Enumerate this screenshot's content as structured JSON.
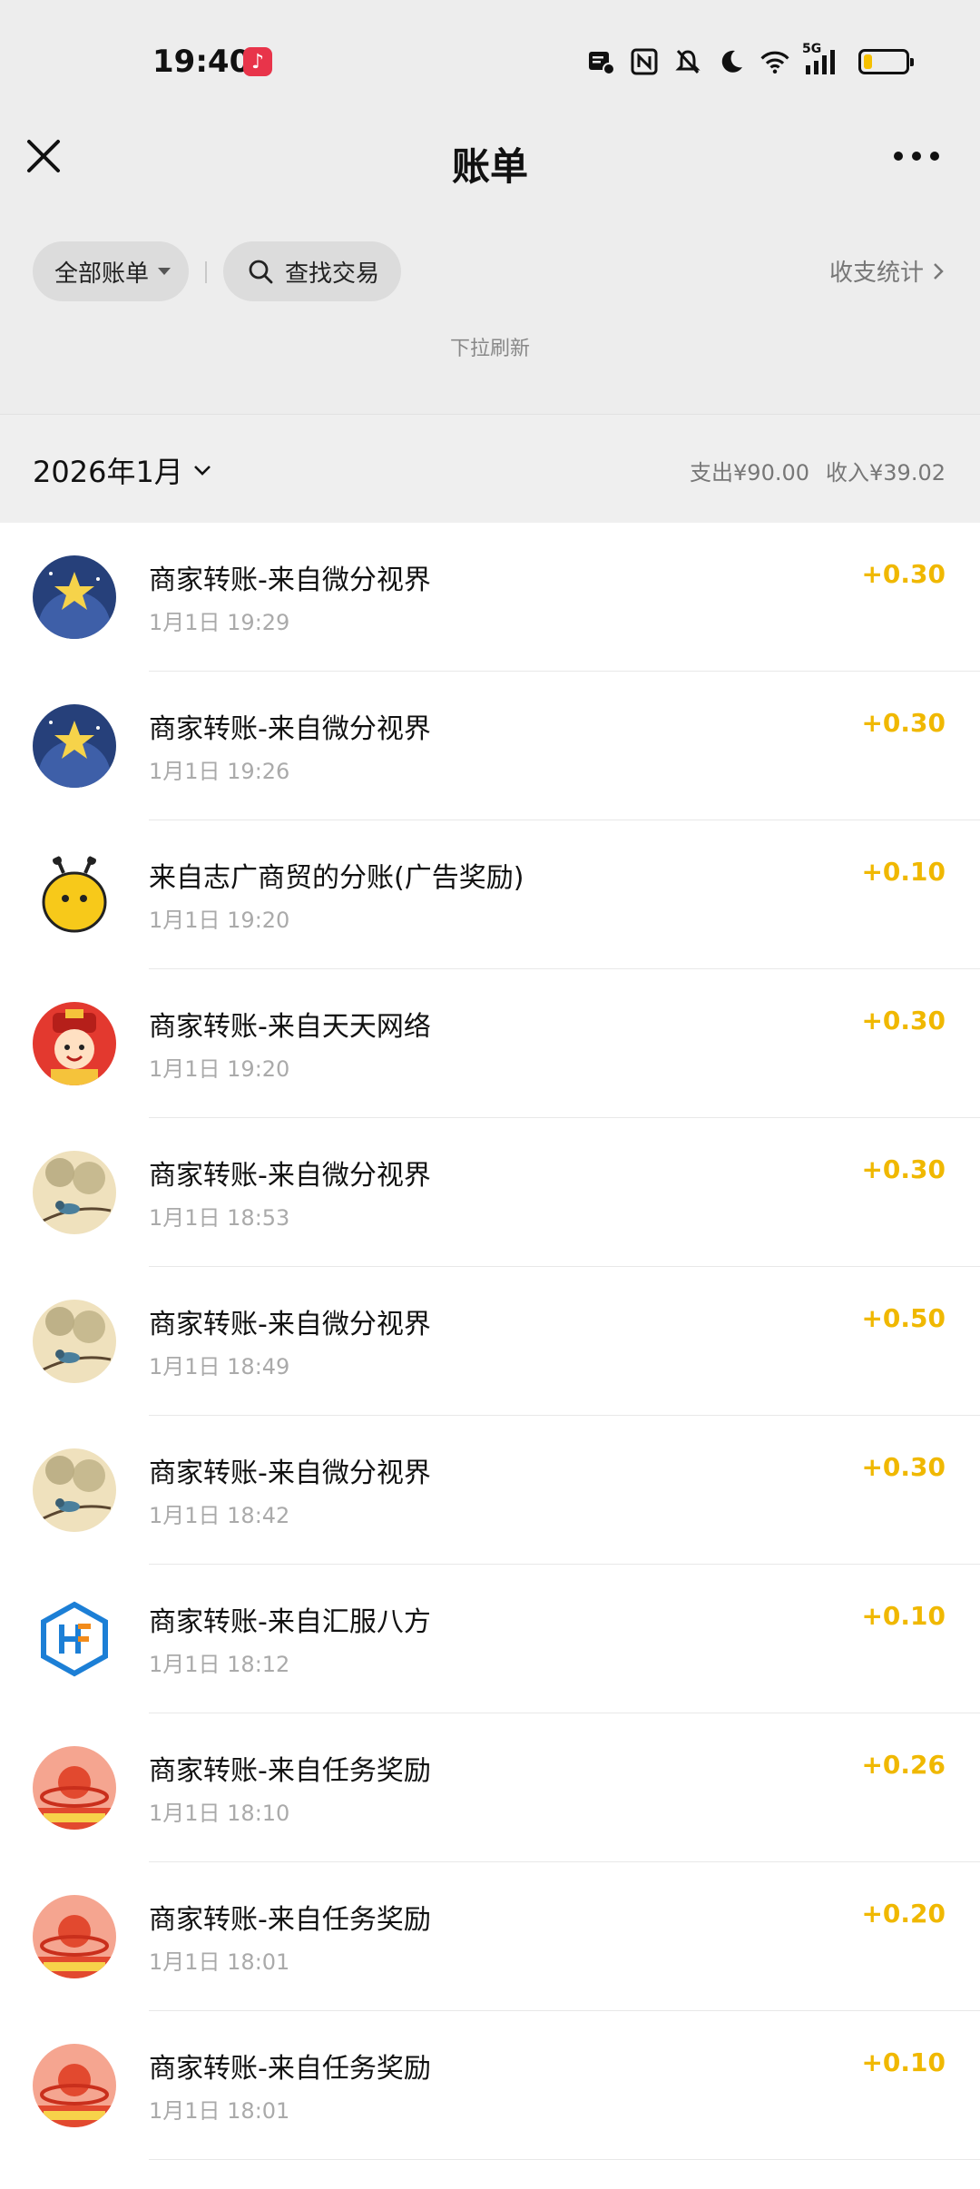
{
  "status_bar": {
    "time": "19:40",
    "network": "5G",
    "battery_level": 0.2,
    "icons": [
      "music-app-icon",
      "notification-icon",
      "nfc-icon",
      "mute-icon",
      "moon-icon",
      "wifi-icon",
      "signal-icon",
      "battery-icon"
    ]
  },
  "header": {
    "title": "账单",
    "close_icon": "close-icon",
    "more_icon": "more-icon"
  },
  "filters": {
    "all_bills": "全部账单",
    "search": "查找交易",
    "stats": "收支统计"
  },
  "pull_hint": "下拉刷新",
  "month_bar": {
    "month": "2026年1月",
    "expense": "支出¥90.00",
    "income": "收入¥39.02"
  },
  "colors": {
    "amount": "#f0b800",
    "background": "#ededed",
    "list_background": "#ffffff"
  },
  "transactions": [
    {
      "title": "商家转账-来自微分视界",
      "time": "1月1日 19:29",
      "amount": "+0.30",
      "avatar": "starry-night-avatar"
    },
    {
      "title": "商家转账-来自微分视界",
      "time": "1月1日 19:26",
      "amount": "+0.30",
      "avatar": "starry-night-avatar"
    },
    {
      "title": "来自志广商贸的分账(广告奖励)",
      "time": "1月1日 19:20",
      "amount": "+0.10",
      "avatar": "bee-avatar"
    },
    {
      "title": "商家转账-来自天天网络",
      "time": "1月1日 19:20",
      "amount": "+0.30",
      "avatar": "cartoon-god-avatar"
    },
    {
      "title": "商家转账-来自微分视界",
      "time": "1月1日 18:53",
      "amount": "+0.30",
      "avatar": "bird-painting-avatar"
    },
    {
      "title": "商家转账-来自微分视界",
      "time": "1月1日 18:49",
      "amount": "+0.50",
      "avatar": "bird-painting-avatar"
    },
    {
      "title": "商家转账-来自微分视界",
      "time": "1月1日 18:42",
      "amount": "+0.30",
      "avatar": "bird-painting-avatar"
    },
    {
      "title": "商家转账-来自汇服八方",
      "time": "1月1日 18:12",
      "amount": "+0.10",
      "avatar": "hf-logo-avatar"
    },
    {
      "title": "商家转账-来自任务奖励",
      "time": "1月1日 18:10",
      "amount": "+0.26",
      "avatar": "reward-app-avatar"
    },
    {
      "title": "商家转账-来自任务奖励",
      "time": "1月1日 18:01",
      "amount": "+0.20",
      "avatar": "reward-app-avatar"
    },
    {
      "title": "商家转账-来自任务奖励",
      "time": "1月1日 18:01",
      "amount": "+0.10",
      "avatar": "reward-app-avatar"
    }
  ]
}
